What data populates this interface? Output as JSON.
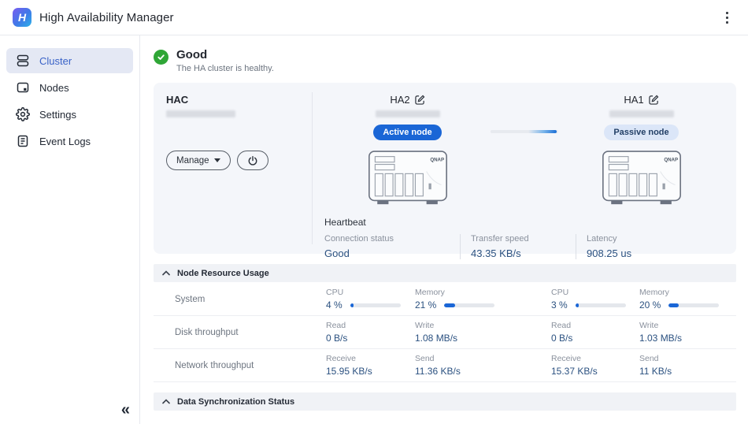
{
  "header": {
    "title": "High Availability Manager",
    "logo_letter": "H"
  },
  "sidebar": {
    "items": [
      {
        "label": "Cluster",
        "icon": "cluster-icon",
        "active": true
      },
      {
        "label": "Nodes",
        "icon": "nodes-icon",
        "active": false
      },
      {
        "label": "Settings",
        "icon": "settings-icon",
        "active": false
      },
      {
        "label": "Event Logs",
        "icon": "event-logs-icon",
        "active": false
      }
    ],
    "collapse_glyph": "«"
  },
  "status": {
    "title": "Good",
    "description": "The HA cluster is healthy."
  },
  "cluster_card": {
    "name": "HAC",
    "manage_label": "Manage",
    "nodes": [
      {
        "name": "HA2",
        "role_label": "Active node",
        "role": "active"
      },
      {
        "name": "HA1",
        "role_label": "Passive node",
        "role": "passive"
      }
    ],
    "heartbeat": {
      "title": "Heartbeat",
      "metrics": [
        {
          "label": "Connection status",
          "value": "Good"
        },
        {
          "label": "Transfer speed",
          "value": "43.35 KB/s"
        },
        {
          "label": "Latency",
          "value": "908.25 us"
        }
      ]
    }
  },
  "resource_section": {
    "title": "Node Resource Usage",
    "rows": [
      {
        "label": "System",
        "cells": [
          {
            "label": "CPU",
            "value": "4 %",
            "bar": 6
          },
          {
            "label": "Memory",
            "value": "21 %",
            "bar": 21
          },
          {
            "label": "CPU",
            "value": "3 %",
            "bar": 5
          },
          {
            "label": "Memory",
            "value": "20 %",
            "bar": 20
          }
        ]
      },
      {
        "label": "Disk throughput",
        "cells": [
          {
            "label": "Read",
            "value": "0 B/s"
          },
          {
            "label": "Write",
            "value": "1.08 MB/s"
          },
          {
            "label": "Read",
            "value": "0 B/s"
          },
          {
            "label": "Write",
            "value": "1.03 MB/s"
          }
        ]
      },
      {
        "label": "Network throughput",
        "cells": [
          {
            "label": "Receive",
            "value": "15.95 KB/s"
          },
          {
            "label": "Send",
            "value": "11.36 KB/s"
          },
          {
            "label": "Receive",
            "value": "15.37 KB/s"
          },
          {
            "label": "Send",
            "value": "11 KB/s"
          }
        ]
      }
    ]
  },
  "sync_section": {
    "title": "Data Synchronization Status"
  },
  "colors": {
    "accent_blue": "#1a66d6",
    "status_green": "#2fa636",
    "value_blue": "#2b5180",
    "active_badge_bg": "#1a66d6",
    "passive_badge_bg": "#dbe6f8",
    "card_bg": "#f4f6fa",
    "sidebar_active_bg": "#e4e8f4"
  }
}
